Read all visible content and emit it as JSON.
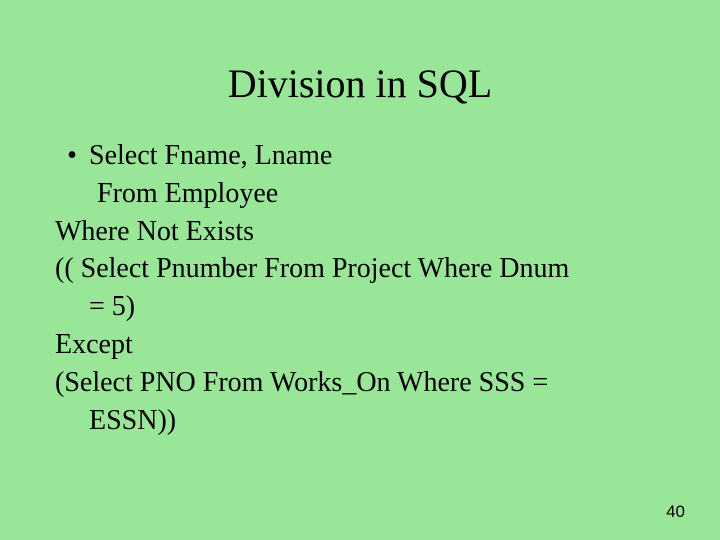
{
  "title": "Division in SQL",
  "bullet_glyph": "•",
  "lines": {
    "l1": "Select Fname, Lname",
    "l2": "From Employee",
    "l3": "Where Not Exists",
    "l4": "(( Select Pnumber From Project Where Dnum = 5)",
    "l5": "Except",
    "l6": "(Select PNO From Works_On Where SSS = ESSN))"
  },
  "page_number": "40"
}
